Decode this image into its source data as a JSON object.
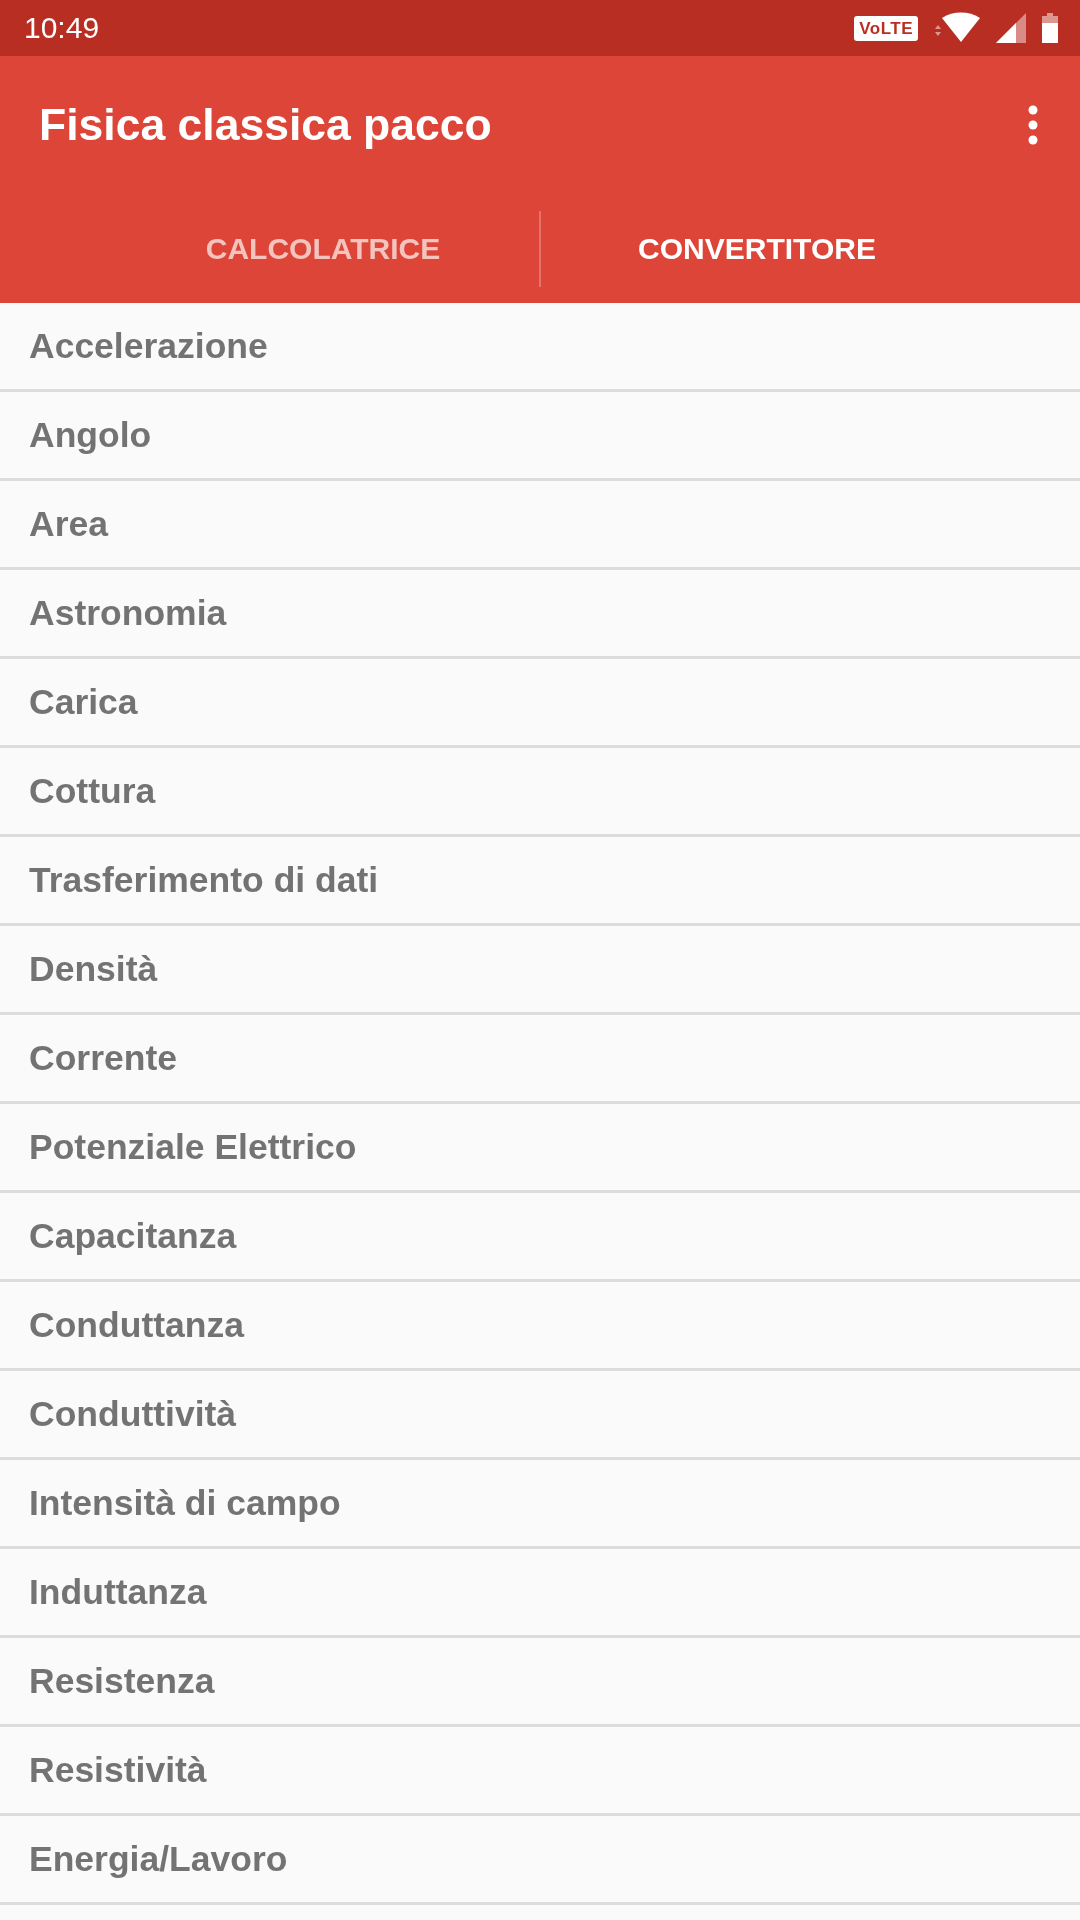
{
  "status_bar": {
    "time": "10:49",
    "volte_label": "VoLTE"
  },
  "app_bar": {
    "title": "Fisica classica pacco"
  },
  "tabs": [
    {
      "label": "CALCOLATRICE",
      "selected": false
    },
    {
      "label": "CONVERTITORE",
      "selected": true
    }
  ],
  "list": {
    "items": [
      {
        "label": "Accelerazione"
      },
      {
        "label": "Angolo"
      },
      {
        "label": "Area"
      },
      {
        "label": "Astronomia"
      },
      {
        "label": "Carica"
      },
      {
        "label": "Cottura"
      },
      {
        "label": "Trasferimento di dati"
      },
      {
        "label": "Densità"
      },
      {
        "label": "Corrente"
      },
      {
        "label": "Potenziale Elettrico"
      },
      {
        "label": "Capacitanza"
      },
      {
        "label": "Conduttanza"
      },
      {
        "label": "Conduttività"
      },
      {
        "label": "Intensità di campo"
      },
      {
        "label": "Induttanza"
      },
      {
        "label": "Resistenza"
      },
      {
        "label": "Resistività"
      },
      {
        "label": "Energia/Lavoro"
      }
    ]
  }
}
